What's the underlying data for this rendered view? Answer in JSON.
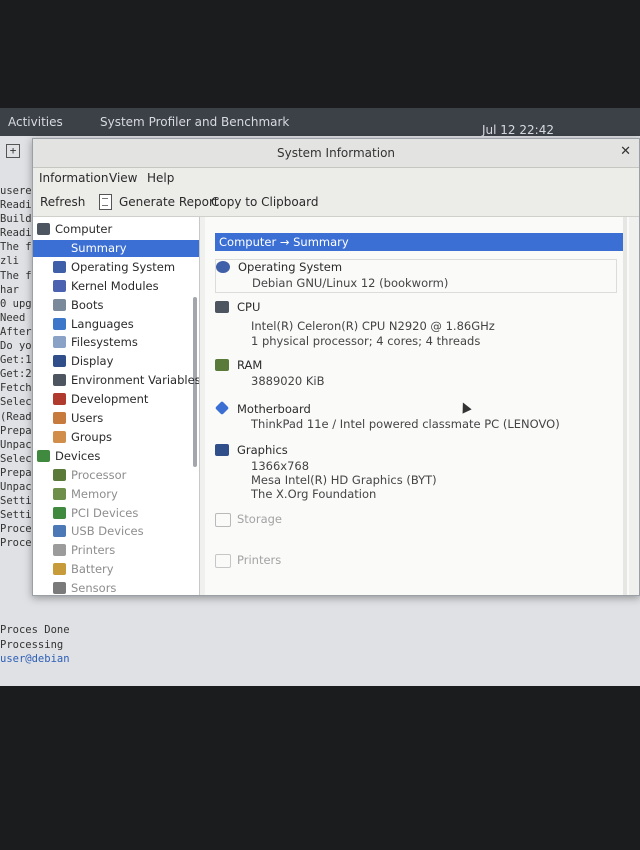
{
  "topbar": {
    "activities": "Activities",
    "app_name": "System Profiler and Benchmark",
    "clock": "Jul 12  22:42"
  },
  "terminal": {
    "lines": [
      "usere",
      "Readi",
      "Build",
      "Readi",
      "The f",
      "  zli",
      "The f",
      "  har",
      "0 upg",
      "Need ",
      "After",
      "Do yo",
      "Get:1",
      "Get:2",
      "Fetch",
      "Selec",
      "(Read",
      "Prepa",
      "Unpac",
      "Selec",
      "Prepa",
      "Unpac",
      "Setti",
      "Setti",
      "Proce",
      "Proce"
    ],
    "tail": [
      "Proces Done",
      "Processing",
      "user@debian"
    ]
  },
  "window": {
    "title": "System Information",
    "menu": {
      "information": "Information",
      "view": "View",
      "help": "Help"
    },
    "toolbar": {
      "refresh": "Refresh",
      "generate_report": "Generate Report",
      "copy": "Copy to Clipboard"
    }
  },
  "sidebar": {
    "computer": "Computer",
    "computer_children": [
      "Summary",
      "Operating System",
      "Kernel Modules",
      "Boots",
      "Languages",
      "Filesystems",
      "Display",
      "Environment Variables",
      "Development",
      "Users",
      "Groups"
    ],
    "devices": "Devices",
    "devices_children": [
      "Processor",
      "Memory",
      "PCI Devices",
      "USB Devices",
      "Printers",
      "Battery",
      "Sensors"
    ],
    "selected": "Summary"
  },
  "content": {
    "header": "Computer → Summary",
    "os": {
      "title": "Operating System",
      "value": "Debian GNU/Linux 12 (bookworm)"
    },
    "cpu": {
      "title": "CPU",
      "lines": [
        "Intel(R) Celeron(R) CPU  N2920  @ 1.86GHz",
        "1 physical processor; 4 cores; 4 threads"
      ]
    },
    "ram": {
      "title": "RAM",
      "value": "3889020 KiB"
    },
    "motherboard": {
      "title": "Motherboard",
      "value": "ThinkPad 11e / Intel powered classmate PC (LENOVO)"
    },
    "graphics": {
      "title": "Graphics",
      "lines": [
        "1366x768",
        "Mesa Intel(R) HD Graphics (BYT)",
        "The X.Org Foundation"
      ]
    },
    "storage": {
      "title": "Storage"
    },
    "printers": {
      "title": "Printers"
    }
  },
  "colors": {
    "accent": "#3b6fd4",
    "topbar": "#3c4047"
  },
  "icons": {
    "computer": "computer-icon",
    "os": "gear-icon",
    "cpu": "cpu-icon",
    "ram": "ram-icon",
    "motherboard": "motherboard-icon",
    "graphics": "monitor-icon",
    "storage": "disk-icon",
    "printers": "printer-icon"
  }
}
